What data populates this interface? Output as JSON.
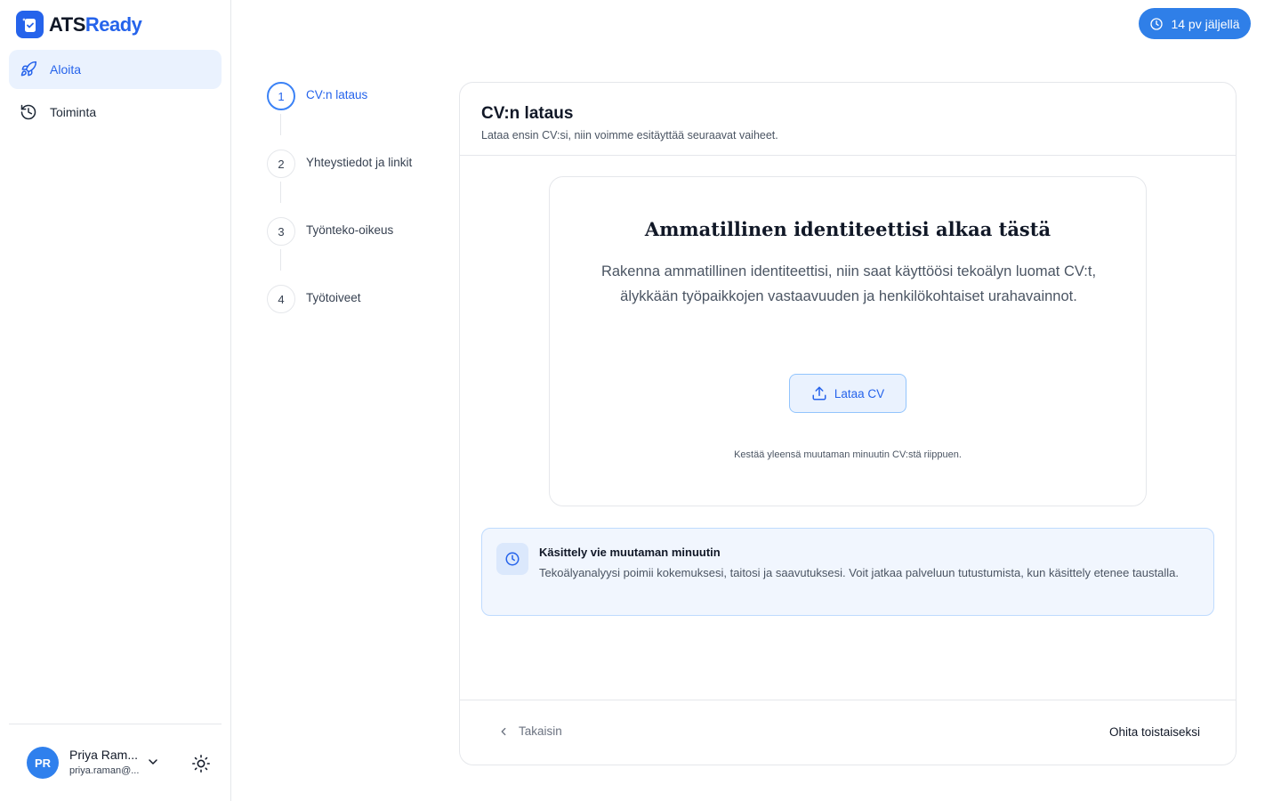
{
  "app": {
    "name_main": "ATS",
    "name_accent": "Ready"
  },
  "sidebar": {
    "items": [
      {
        "label": "Aloita",
        "icon": "rocket-icon",
        "active": true
      },
      {
        "label": "Toiminta",
        "icon": "history-icon",
        "active": false
      }
    ]
  },
  "user": {
    "initials": "PR",
    "name": "Priya Ram...",
    "email": "priya.raman@..."
  },
  "trial": {
    "label": "14 pv jäljellä",
    "icon": "clock-icon"
  },
  "steps": [
    {
      "number": "1",
      "label": "CV:n lataus",
      "active": true
    },
    {
      "number": "2",
      "label": "Yhteystiedot ja linkit",
      "active": false
    },
    {
      "number": "3",
      "label": "Työnteko-oikeus",
      "active": false
    },
    {
      "number": "4",
      "label": "Työtoiveet",
      "active": false
    }
  ],
  "card": {
    "title": "CV:n lataus",
    "subtitle": "Lataa ensin CV:si, niin voimme esitäyttää seuraavat vaiheet."
  },
  "upload": {
    "title": "Ammatillinen identiteettisi alkaa tästä",
    "text": "Rakenna ammatillinen identiteettisi, niin saat käyttöösi tekoälyn luomat CV:t, älykkään työpaikkojen vastaavuuden ja henkilökohtaiset urahavainnot.",
    "button_label": "Lataa CV",
    "note": "Kestää yleensä muutaman minuutin CV:stä riippuen."
  },
  "info": {
    "title": "Käsittely vie muutaman minuutin",
    "text": "Tekoälyanalyysi poimii kokemuksesi, taitosi ja saavutuksesi. Voit jatkaa palveluun tutustumista, kun käsittely etenee taustalla."
  },
  "footer": {
    "back_label": "Takaisin",
    "skip_label": "Ohita toistaiseksi"
  },
  "colors": {
    "accent": "#2563eb",
    "accent_light": "#eaf2fe",
    "trial_bg": "#2f7fe8"
  }
}
